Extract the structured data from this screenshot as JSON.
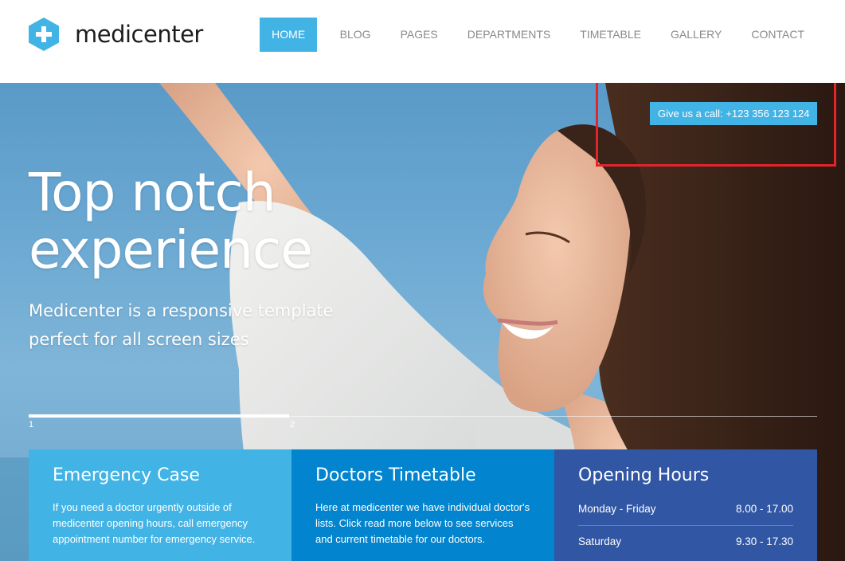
{
  "brand": {
    "name": "medicenter",
    "accent": "#42b3e5"
  },
  "nav": {
    "items": [
      {
        "label": "HOME",
        "active": true
      },
      {
        "label": "BLOG",
        "active": false
      },
      {
        "label": "PAGES",
        "active": false
      },
      {
        "label": "DEPARTMENTS",
        "active": false
      },
      {
        "label": "TIMETABLE",
        "active": false
      },
      {
        "label": "GALLERY",
        "active": false
      },
      {
        "label": "CONTACT",
        "active": false
      }
    ]
  },
  "hero": {
    "call_label": "Give us a call: +123 356 123 124",
    "title_line1": "Top notch",
    "title_line2": "experience",
    "subtitle_line1": "Medicenter is a responsive template",
    "subtitle_line2": "perfect for all screen sizes",
    "slides": [
      "1",
      "2"
    ],
    "progress": 0.33
  },
  "boxes": {
    "emergency": {
      "title": "Emergency Case",
      "text": "If you need a doctor urgently outside of medicenter opening hours, call emergency appointment number for emergency service.",
      "color": "#42b3e5"
    },
    "timetable": {
      "title": "Doctors Timetable",
      "text": "Here at medicenter we have individual doctor's lists. Click read more below to see services and current timetable for our doctors.",
      "color": "#0384ce"
    },
    "hours": {
      "title": "Opening Hours",
      "color": "#3156a3",
      "rows": [
        {
          "day": "Monday - Friday",
          "time": "8.00 - 17.00"
        },
        {
          "day": "Saturday",
          "time": "9.30 - 17.30"
        }
      ]
    }
  },
  "highlight_color": "#e3242b"
}
